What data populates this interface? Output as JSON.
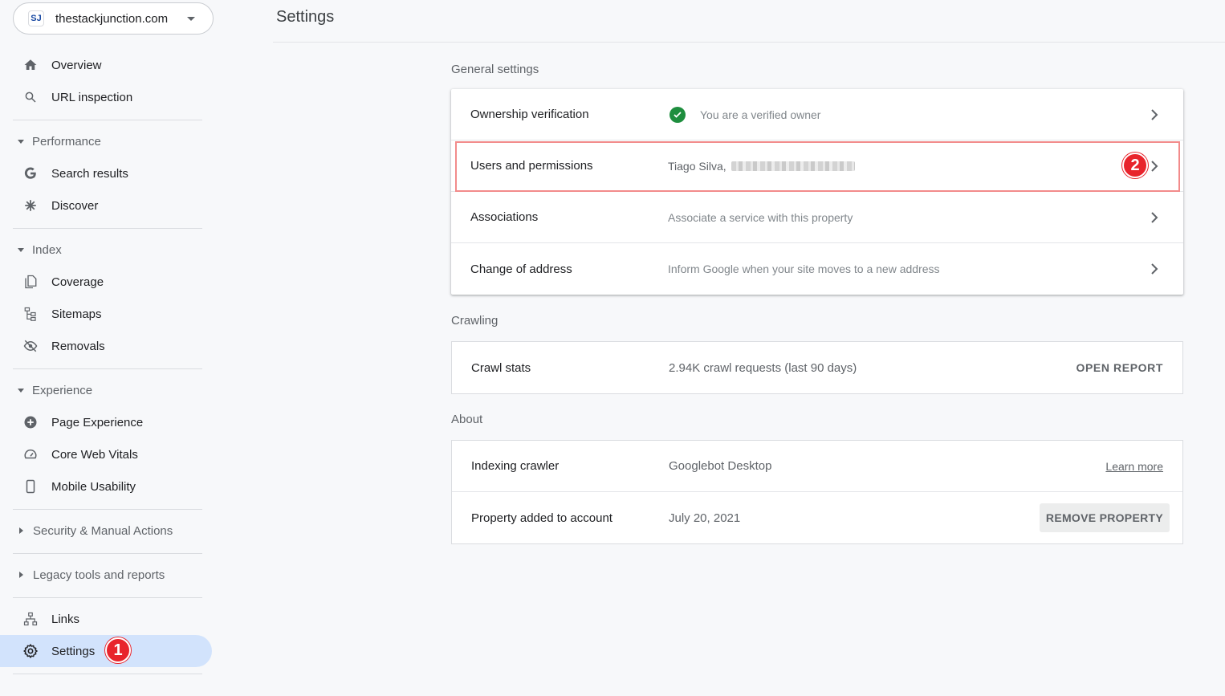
{
  "property": {
    "logo_text": "SJ",
    "name": "thestackjunction.com"
  },
  "nav": {
    "overview": "Overview",
    "url_inspection": "URL inspection",
    "performance": "Performance",
    "search_results": "Search results",
    "discover": "Discover",
    "index": "Index",
    "coverage": "Coverage",
    "sitemaps": "Sitemaps",
    "removals": "Removals",
    "experience": "Experience",
    "page_experience": "Page Experience",
    "core_web_vitals": "Core Web Vitals",
    "mobile_usability": "Mobile Usability",
    "security": "Security & Manual Actions",
    "legacy": "Legacy tools and reports",
    "links": "Links",
    "settings": "Settings"
  },
  "badges": {
    "one": "1",
    "two": "2"
  },
  "header": {
    "title": "Settings"
  },
  "general": {
    "title": "General settings",
    "ownership": {
      "label": "Ownership verification",
      "value": "You are a verified owner"
    },
    "users": {
      "label": "Users and permissions",
      "value": "Tiago Silva,"
    },
    "associations": {
      "label": "Associations",
      "value": "Associate a service with this property"
    },
    "address": {
      "label": "Change of address",
      "value": "Inform Google when your site moves to a new address"
    }
  },
  "crawling": {
    "title": "Crawling",
    "crawl_stats": {
      "label": "Crawl stats",
      "value": "2.94K crawl requests (last 90 days)",
      "action": "OPEN REPORT"
    }
  },
  "about": {
    "title": "About",
    "crawler": {
      "label": "Indexing crawler",
      "value": "Googlebot Desktop",
      "action": "Learn more"
    },
    "added": {
      "label": "Property added to account",
      "value": "July 20, 2021",
      "action": "REMOVE PROPERTY"
    }
  },
  "colors": {
    "accent_active": "#d2e3fc",
    "badge": "#e8242c",
    "verified": "#1e8e3e",
    "highlight": "#f28b8b"
  }
}
